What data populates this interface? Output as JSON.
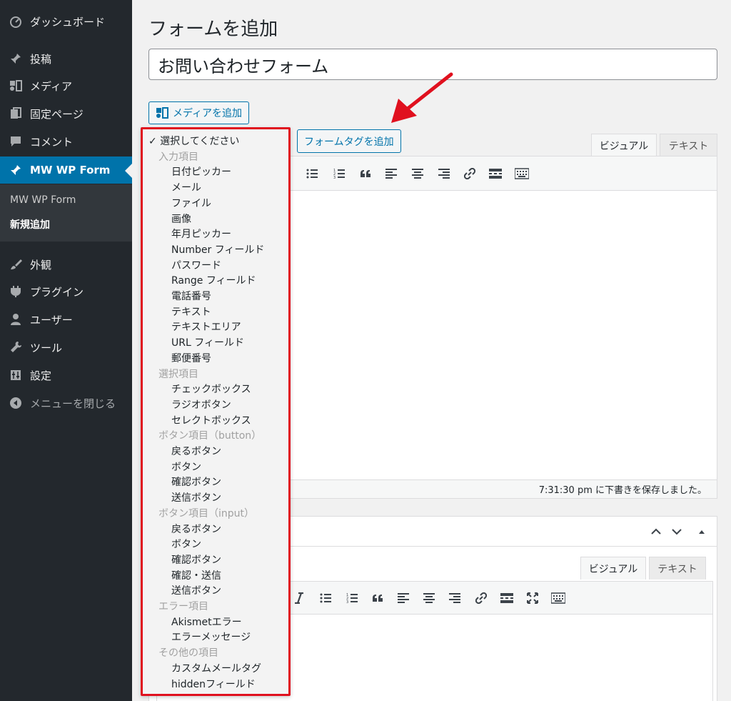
{
  "sidebar": {
    "items": [
      {
        "label": "ダッシュボード",
        "icon": "dashboard-icon"
      },
      {
        "label": "投稿",
        "icon": "pin-icon"
      },
      {
        "label": "メディア",
        "icon": "media-icon"
      },
      {
        "label": "固定ページ",
        "icon": "pages-icon"
      },
      {
        "label": "コメント",
        "icon": "comment-icon"
      },
      {
        "label": "MW WP Form",
        "icon": "pin-icon",
        "active": true
      },
      {
        "label": "外観",
        "icon": "brush-icon"
      },
      {
        "label": "プラグイン",
        "icon": "plugin-icon"
      },
      {
        "label": "ユーザー",
        "icon": "user-icon"
      },
      {
        "label": "ツール",
        "icon": "wrench-icon"
      },
      {
        "label": "設定",
        "icon": "settings-icon"
      },
      {
        "label": "メニューを閉じる",
        "icon": "collapse-icon"
      }
    ],
    "submenu": [
      "MW WP Form",
      "新規追加"
    ]
  },
  "main": {
    "page_title": "フォームを追加",
    "title_value": "お問い合わせフォーム",
    "add_media_label": "メディアを追加",
    "add_form_tag_label": "フォームタグを追加"
  },
  "editor1": {
    "tab_visual": "ビジュアル",
    "tab_text": "テキスト",
    "status": "7:31:30 pm に下書きを保存しました。"
  },
  "editor2": {
    "tab_visual": "ビジュアル",
    "tab_text": "テキスト"
  },
  "dropdown": {
    "selected": "✓ 選択してください",
    "groups": [
      {
        "label": "入力項目",
        "options": [
          "日付ピッカー",
          "メール",
          "ファイル",
          "画像",
          "年月ピッカー",
          "Number フィールド",
          "パスワード",
          "Range フィールド",
          "電話番号",
          "テキスト",
          "テキストエリア",
          "URL フィールド",
          "郵便番号"
        ]
      },
      {
        "label": "選択項目",
        "options": [
          "チェックボックス",
          "ラジオボタン",
          "セレクトボックス"
        ]
      },
      {
        "label": "ボタン項目（button）",
        "options": [
          "戻るボタン",
          "ボタン",
          "確認ボタン",
          "送信ボタン"
        ]
      },
      {
        "label": "ボタン項目（input）",
        "options": [
          "戻るボタン",
          "ボタン",
          "確認ボタン",
          "確認・送信",
          "送信ボタン"
        ]
      },
      {
        "label": "エラー項目",
        "options": [
          "Akismetエラー",
          "エラーメッセージ"
        ]
      },
      {
        "label": "その他の項目",
        "options": [
          "カスタムメールタグ",
          "hiddenフィールド"
        ]
      }
    ]
  },
  "colors": {
    "sidebar_bg": "#23282d",
    "active_bg": "#0073aa",
    "highlight_red": "#e0101e"
  }
}
